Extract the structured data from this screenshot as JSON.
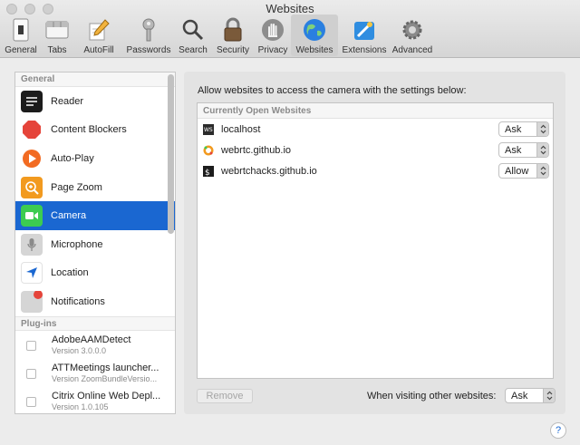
{
  "window": {
    "title": "Websites"
  },
  "toolbar": {
    "items": [
      {
        "label": "General",
        "icon": "general-icon"
      },
      {
        "label": "Tabs",
        "icon": "tabs-icon"
      },
      {
        "label": "AutoFill",
        "icon": "autofill-icon"
      },
      {
        "label": "Passwords",
        "icon": "key-icon"
      },
      {
        "label": "Search",
        "icon": "search-icon"
      },
      {
        "label": "Security",
        "icon": "lock-icon"
      },
      {
        "label": "Privacy",
        "icon": "hand-icon"
      },
      {
        "label": "Websites",
        "icon": "globe-icon",
        "active": true
      },
      {
        "label": "Extensions",
        "icon": "extensions-icon"
      },
      {
        "label": "Advanced",
        "icon": "gear-icon"
      }
    ]
  },
  "sidebar": {
    "general_header": "General",
    "items": [
      {
        "label": "Reader",
        "icon": "reader-icon",
        "color": "#1c1c1c"
      },
      {
        "label": "Content Blockers",
        "icon": "stop-icon",
        "color": "#e5443a"
      },
      {
        "label": "Auto-Play",
        "icon": "play-icon",
        "color": "#f26b22"
      },
      {
        "label": "Page Zoom",
        "icon": "zoom-icon",
        "color": "#f29a1f"
      },
      {
        "label": "Camera",
        "icon": "camera-icon",
        "color": "#3ccc51",
        "selected": true
      },
      {
        "label": "Microphone",
        "icon": "microphone-icon",
        "color": "#d5d5d5"
      },
      {
        "label": "Location",
        "icon": "location-icon",
        "color": "#ffffff"
      },
      {
        "label": "Notifications",
        "icon": "notifications-icon",
        "color": "#d5d5d5"
      }
    ],
    "plugins_header": "Plug-ins",
    "plugins": [
      {
        "name": "AdobeAAMDetect",
        "version": "Version 3.0.0.0"
      },
      {
        "name": "ATTMeetings launcher...",
        "version": "Version ZoomBundleVersio..."
      },
      {
        "name": "Citrix Online Web Depl...",
        "version": "Version 1.0.105"
      }
    ]
  },
  "main": {
    "intro": "Allow websites to access the camera with the settings below:",
    "list_header": "Currently Open Websites",
    "sites": [
      {
        "name": "localhost",
        "setting": "Ask"
      },
      {
        "name": "webrtc.github.io",
        "setting": "Ask"
      },
      {
        "name": "webrtchacks.github.io",
        "setting": "Allow"
      }
    ],
    "remove_label": "Remove",
    "other_label": "When visiting other websites:",
    "other_setting": "Ask"
  },
  "help": "?",
  "accent": "#1a67d1"
}
